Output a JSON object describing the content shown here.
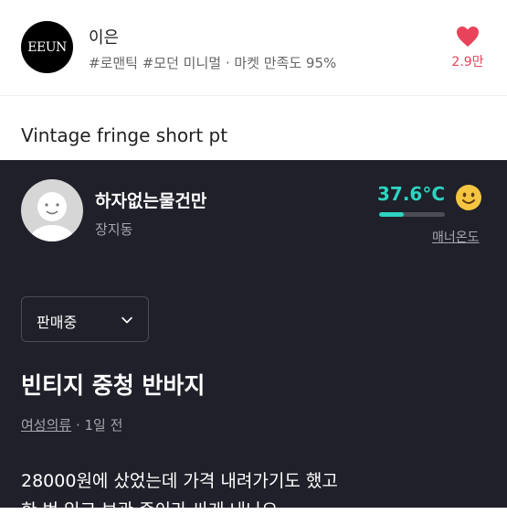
{
  "shop": {
    "logo_text": "EEUN",
    "name": "이은",
    "tags": "#로맨틱 #모던 미니멀 · 마켓 만족도 95%",
    "likes": "2.9만"
  },
  "product": {
    "title_en": "Vintage fringe short pt"
  },
  "seller": {
    "name": "하자없는물건만",
    "location": "장지동",
    "temperature": "37.6°C",
    "temperature_level_percent": 37.6,
    "manner_label": "매너온도"
  },
  "status": {
    "selected": "판매중"
  },
  "listing": {
    "title": "빈티지 중청 반바지",
    "category": "여성의류",
    "separator": " · ",
    "time": "1일 전",
    "description_line1": "28000원에 샀었는데 가격 내려가기도 했고",
    "description_line2": "한 번 입고 보관 중이라 싸게 내놔요"
  },
  "colors": {
    "accent_teal": "#2ed3c1",
    "heart": "#e8435a",
    "dark_bg": "#1f2029"
  }
}
